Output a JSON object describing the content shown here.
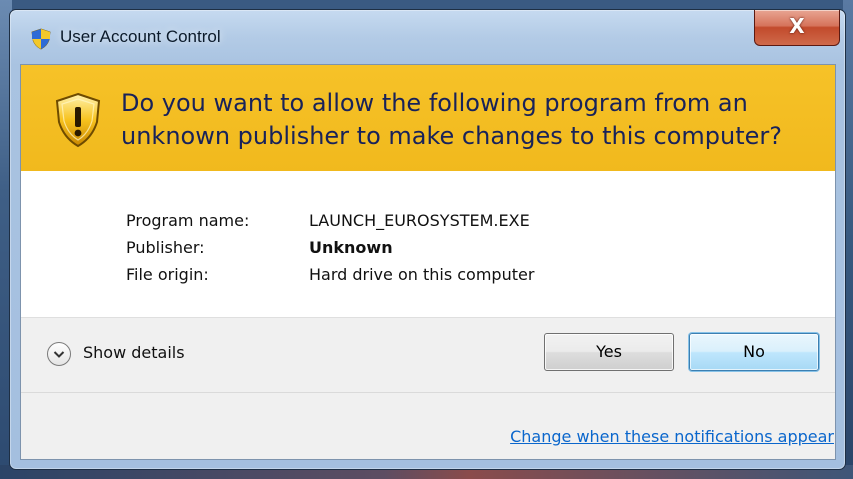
{
  "window": {
    "title": "User Account Control",
    "close_glyph": "X",
    "title_icon": "uac-shield-icon"
  },
  "banner": {
    "icon": "warning-shield-icon",
    "question": "Do you want to allow the following program from an unknown publisher to make changes to this computer?",
    "background_color": "#f4bd22",
    "text_color": "#18225a"
  },
  "program_info": {
    "rows": [
      {
        "label": "Program name:",
        "value": "LAUNCH_EUROSYSTEM.EXE"
      },
      {
        "label": "Publisher:",
        "value": "Unknown"
      },
      {
        "label": "File origin:",
        "value": "Hard drive on this computer"
      }
    ]
  },
  "actions": {
    "details_toggle_label": "Show details",
    "details_icon": "chevron-down-icon",
    "yes_label": "Yes",
    "no_label": "No",
    "default_button": "No"
  },
  "footer": {
    "link_text": "Change when these notifications appear",
    "link_color": "#0a66cc"
  }
}
